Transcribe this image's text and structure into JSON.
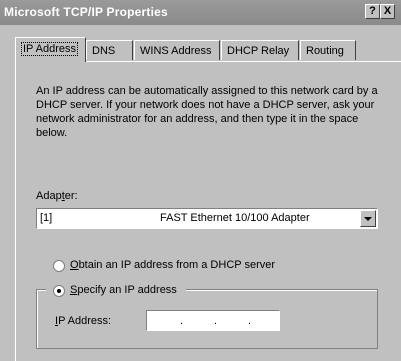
{
  "window": {
    "title": "Microsoft TCP/IP Properties",
    "help_button": "?",
    "close_button": "X"
  },
  "tabs": [
    "IP Address",
    "DNS",
    "WINS Address",
    "DHCP Relay",
    "Routing"
  ],
  "intro_text": "An IP address can be automatically assigned to this network card by a DHCP server.  If your network does not have a DHCP server, ask your network administrator for an address, and then type it in the space below.",
  "adapter": {
    "label_before": "Adap",
    "label_underlined": "t",
    "label_after": "er:",
    "selected_index": "[1]",
    "selected_name": "FAST Ethernet 10/100 Adapter"
  },
  "options": {
    "obtain": {
      "underlined": "O",
      "rest": "btain an IP address from a DHCP server",
      "checked": false
    },
    "specify": {
      "underlined": "S",
      "rest": "pecify an IP address",
      "checked": true
    }
  },
  "ip_address": {
    "label_underlined": "I",
    "label_rest": "P Address:",
    "value_parts": [
      "",
      "",
      "",
      ""
    ],
    "separator": "."
  }
}
